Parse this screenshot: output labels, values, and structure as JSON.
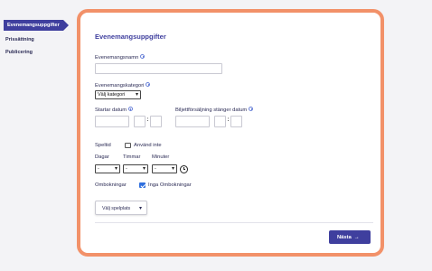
{
  "sidebar": {
    "items": [
      {
        "label": "Evenemangsuppgifter",
        "active": true
      },
      {
        "label": "Prissättning",
        "active": false
      },
      {
        "label": "Publicering",
        "active": false
      }
    ]
  },
  "form": {
    "title": "Evenemangsuppgifter",
    "event_name_label": "Evenemangsnamn",
    "event_name_value": "",
    "category_label": "Evenemangskategori",
    "category_selected": "Välj kategori",
    "start_date_label": "Startar datum",
    "time_separator": ":",
    "ticket_close_label": "Biljettförsäljning stänger datum",
    "playtime_label": "Speltid",
    "no_playtime_label": "Använd inte",
    "no_playtime_checked": false,
    "days_label": "Dagar",
    "hours_label": "Timmar",
    "minutes_label": "Minuter",
    "duration_placeholder": "-",
    "rebooking_label": "Ombokningar",
    "no_rebooking_label": "Inga Ombokningar",
    "no_rebooking_checked": true,
    "venue_button_label": "Välj spelplats",
    "next_button_label": "Nästa"
  },
  "colors": {
    "accent": "#3f3f9e",
    "card_border": "#f29169",
    "checkbox_checked": "#2f6fde"
  },
  "icons": [
    "info-icon",
    "clock-icon",
    "chevron-down-icon",
    "arrow-right-icon"
  ]
}
